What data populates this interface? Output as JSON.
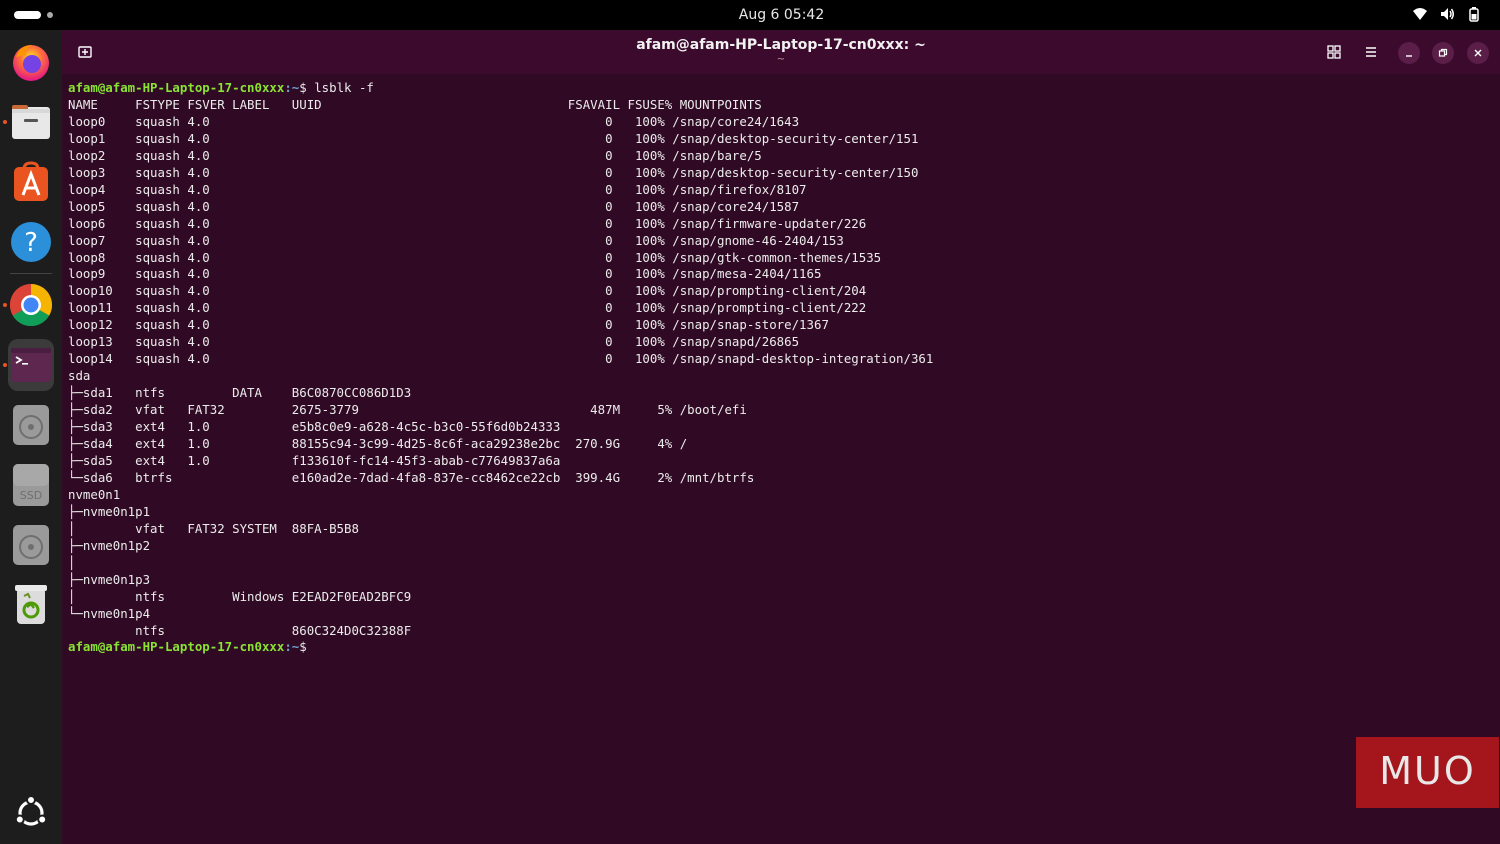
{
  "topbar": {
    "clock": "Aug 6  05:42",
    "tray_icons": [
      "wifi-icon",
      "volume-icon",
      "battery-icon"
    ]
  },
  "dock": {
    "items": [
      {
        "name": "firefox-icon"
      },
      {
        "name": "files-icon"
      },
      {
        "name": "app-center-icon"
      },
      {
        "name": "help-icon"
      },
      {
        "name": "chrome-icon"
      },
      {
        "name": "terminal-icon"
      },
      {
        "name": "disk-icon"
      },
      {
        "name": "ssd-icon",
        "label": "SSD"
      },
      {
        "name": "disk-icon"
      },
      {
        "name": "trash-icon"
      },
      {
        "name": "show-apps-icon"
      }
    ]
  },
  "window": {
    "title": "afam@afam-HP-Laptop-17-cn0xxx: ~",
    "subtitle": "~"
  },
  "terminal": {
    "prompt_user": "afam@afam-HP-Laptop-17-cn0xxx",
    "prompt_path": ":~",
    "prompt_symbol": "$ ",
    "command": "lsblk -f",
    "output_lines": [
      "NAME     FSTYPE FSVER LABEL   UUID                                 FSAVAIL FSUSE% MOUNTPOINTS",
      "loop0    squash 4.0                                                     0   100% /snap/core24/1643",
      "loop1    squash 4.0                                                     0   100% /snap/desktop-security-center/151",
      "loop2    squash 4.0                                                     0   100% /snap/bare/5",
      "loop3    squash 4.0                                                     0   100% /snap/desktop-security-center/150",
      "loop4    squash 4.0                                                     0   100% /snap/firefox/8107",
      "loop5    squash 4.0                                                     0   100% /snap/core24/1587",
      "loop6    squash 4.0                                                     0   100% /snap/firmware-updater/226",
      "loop7    squash 4.0                                                     0   100% /snap/gnome-46-2404/153",
      "loop8    squash 4.0                                                     0   100% /snap/gtk-common-themes/1535",
      "loop9    squash 4.0                                                     0   100% /snap/mesa-2404/1165",
      "loop10   squash 4.0                                                     0   100% /snap/prompting-client/204",
      "loop11   squash 4.0                                                     0   100% /snap/prompting-client/222",
      "loop12   squash 4.0                                                     0   100% /snap/snap-store/1367",
      "loop13   squash 4.0                                                     0   100% /snap/snapd/26865",
      "loop14   squash 4.0                                                     0   100% /snap/snapd-desktop-integration/361",
      "sda",
      "├─sda1   ntfs         DATA    B6C0870CC086D1D3",
      "├─sda2   vfat   FAT32         2675-3779                               487M     5% /boot/efi",
      "├─sda3   ext4   1.0           e5b8c0e9-a628-4c5c-b3c0-55f6d0b24333",
      "├─sda4   ext4   1.0           88155c94-3c99-4d25-8c6f-aca29238e2bc  270.9G     4% /",
      "├─sda5   ext4   1.0           f133610f-fc14-45f3-abab-c77649837a6a",
      "└─sda6   btrfs                e160ad2e-7dad-4fa8-837e-cc8462ce22cb  399.4G     2% /mnt/btrfs",
      "nvme0n1",
      "├─nvme0n1p1",
      "│        vfat   FAT32 SYSTEM  88FA-B5B8",
      "├─nvme0n1p2",
      "│",
      "├─nvme0n1p3",
      "│        ntfs         Windows E2EAD2F0EAD2BFC9",
      "└─nvme0n1p4",
      "         ntfs                 860C324D0C32388F"
    ]
  },
  "watermark": {
    "text": "MUO",
    "color": "#a4161c"
  },
  "colors": {
    "terminal_bg": "#300a24",
    "titlebar_bg": "#3b0a2d",
    "prompt_user": "#8ae234",
    "prompt_path": "#729fcf"
  }
}
